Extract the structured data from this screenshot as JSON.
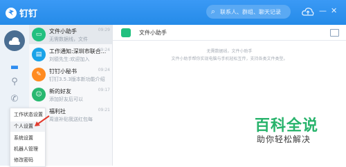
{
  "app": {
    "name": "钉钉"
  },
  "search": {
    "placeholder": "联系人、群组、聊天记录"
  },
  "conversations": [
    {
      "title": "文件小助手",
      "subtitle": "无需数据线，文件",
      "time": "09:29"
    },
    {
      "title": "工作通知:深圳市联合...",
      "subtitle": "刘德先生:欢迎加入",
      "time": "09:24"
    },
    {
      "title": "钉钉小秘书",
      "subtitle": "钉钉3.5.3版本新功能介绍",
      "time": "09:24"
    },
    {
      "title": "新的好友",
      "subtitle": "添加好友后可以",
      "time": "09:17"
    },
    {
      "title": "福利社",
      "subtitle": "周道补贴我送红包每",
      "time": "09:21"
    }
  ],
  "chat": {
    "title": "文件小助手",
    "lines": [
      "无需数据线，文件小助手",
      "文件小助手帮你实现电脑与手机轻松互传，支持各类文件类型。"
    ]
  },
  "menu": {
    "items": [
      "工作状态设置",
      "个人设置",
      "系统设置",
      "机器人管理",
      "修改密码"
    ]
  },
  "watermark": {
    "title": "百科全说",
    "subtitle": "助你轻松解决"
  },
  "colors": {
    "accent": "#2d8cf0",
    "watermark_green": "#27b36b",
    "arrow_red": "#e23b2e"
  }
}
